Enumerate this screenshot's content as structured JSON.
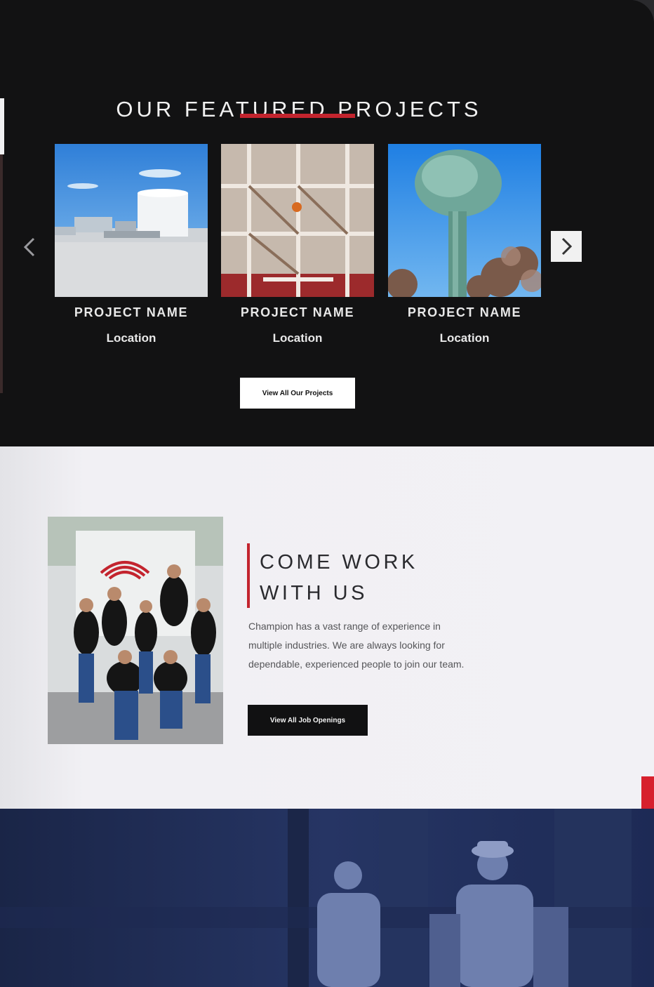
{
  "projects": {
    "title": "OUR FEATURED PROJECTS",
    "items": [
      {
        "name": "PROJECT NAME",
        "location": "Location",
        "image": "industrial-plant-photo"
      },
      {
        "name": "PROJECT NAME",
        "location": "Location",
        "image": "scaffolding-interior-photo"
      },
      {
        "name": "PROJECT NAME",
        "location": "Location",
        "image": "water-tower-photo"
      }
    ],
    "prev_icon": "chevron-left-icon",
    "next_icon": "chevron-right-icon",
    "button_label": "View All Our Projects"
  },
  "work": {
    "title_line1": "COME WORK",
    "title_line2": "WITH US",
    "text": "Champion has a vast range of experience in multiple industries. We are always looking for dependable, experienced people to join our team.",
    "button_label": "View All Job Openings",
    "image": "team-group-photo"
  },
  "hero": {
    "image": "workers-blue-photo"
  },
  "colors": {
    "accent": "#c3242e",
    "dark": "#121213",
    "light_bg": "#f2f1f5",
    "hero_blue": "#1f2a4f"
  }
}
